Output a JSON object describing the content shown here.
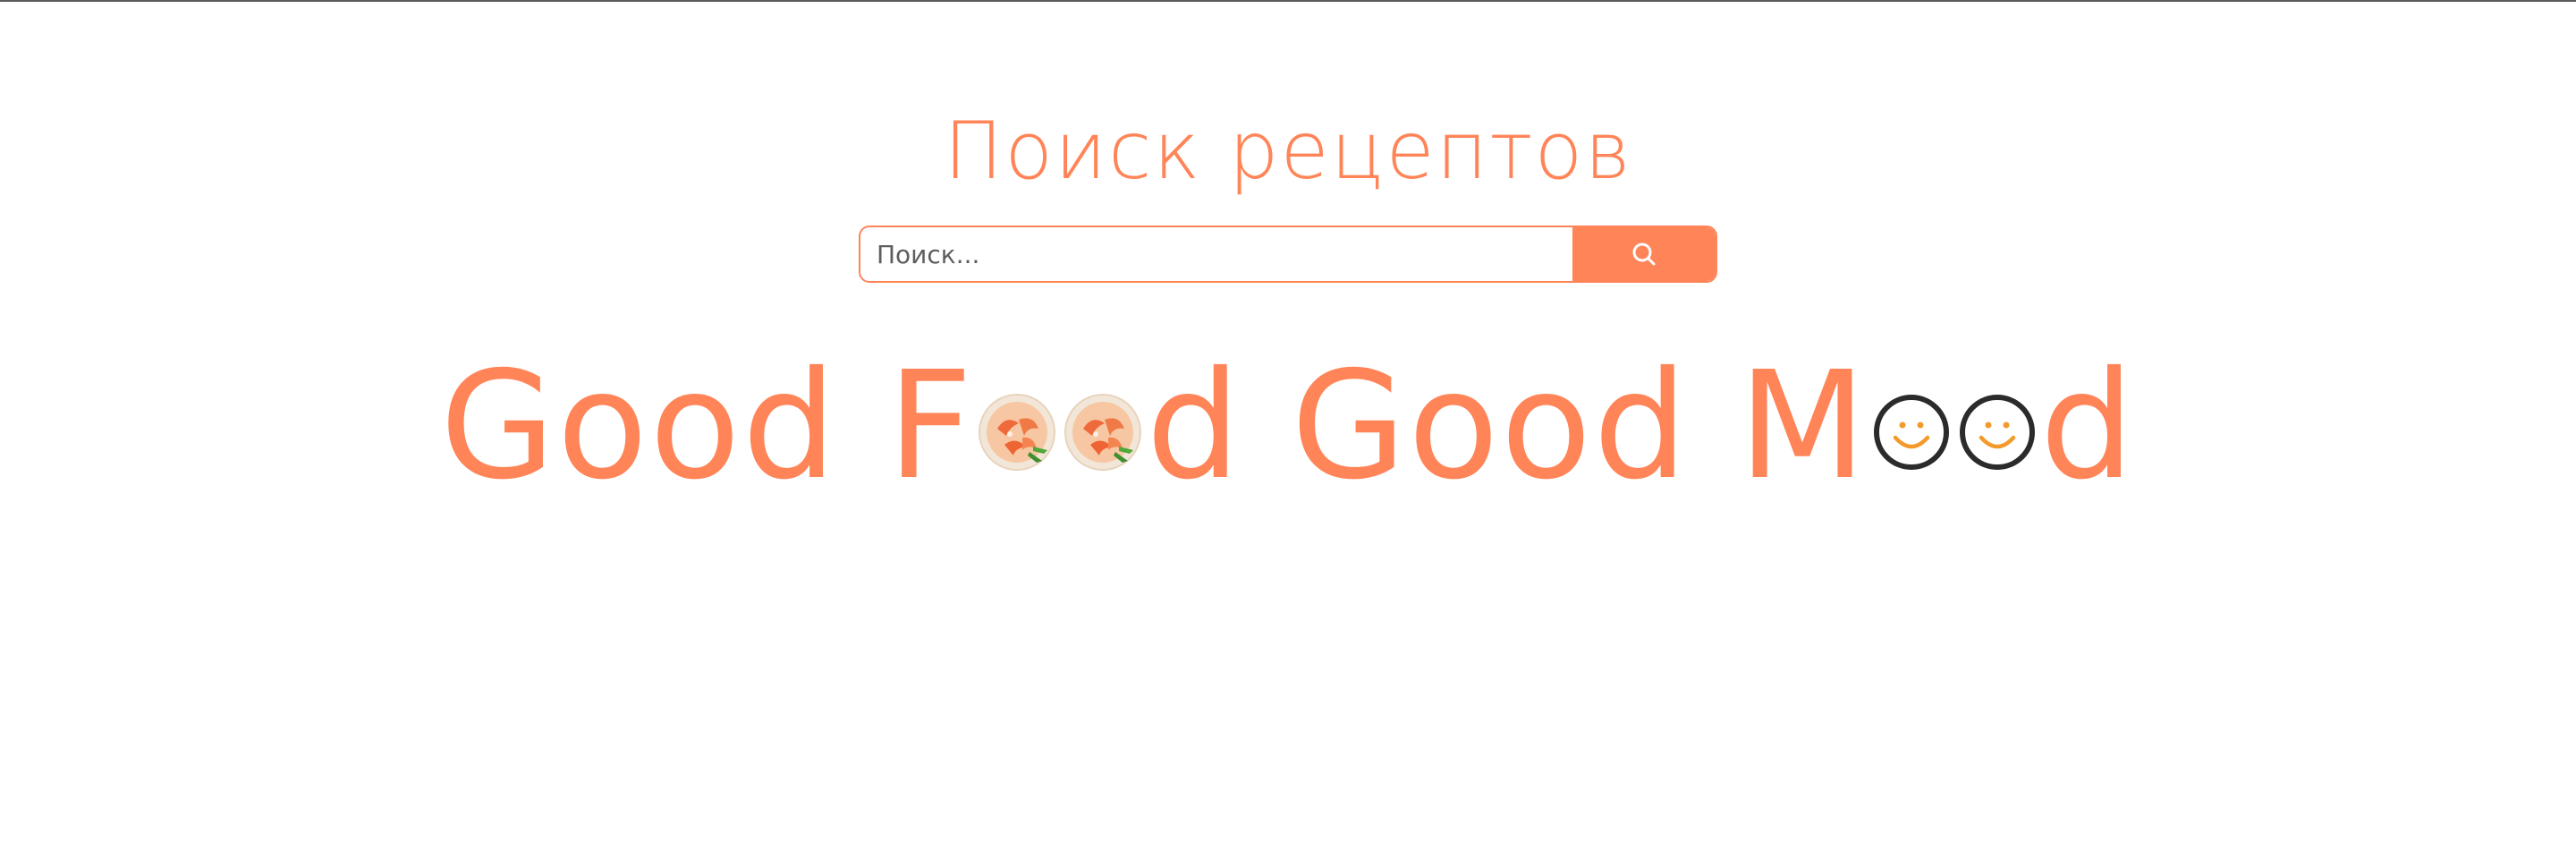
{
  "page": {
    "title": "Поиск рецептов"
  },
  "search": {
    "placeholder": "Поиск...",
    "value": "",
    "button_icon": "search-icon"
  },
  "brand": {
    "part1": "Good F",
    "part2": "d Good M",
    "part3": "d",
    "food_icons": [
      "shrimp-plate-icon",
      "shrimp-plate-icon"
    ],
    "mood_icons": [
      "smiley-icon",
      "smiley-icon"
    ]
  },
  "colors": {
    "accent": "#ff8559",
    "smiley_stroke": "#2b2b2b",
    "smiley_face": "#f39a2a"
  }
}
